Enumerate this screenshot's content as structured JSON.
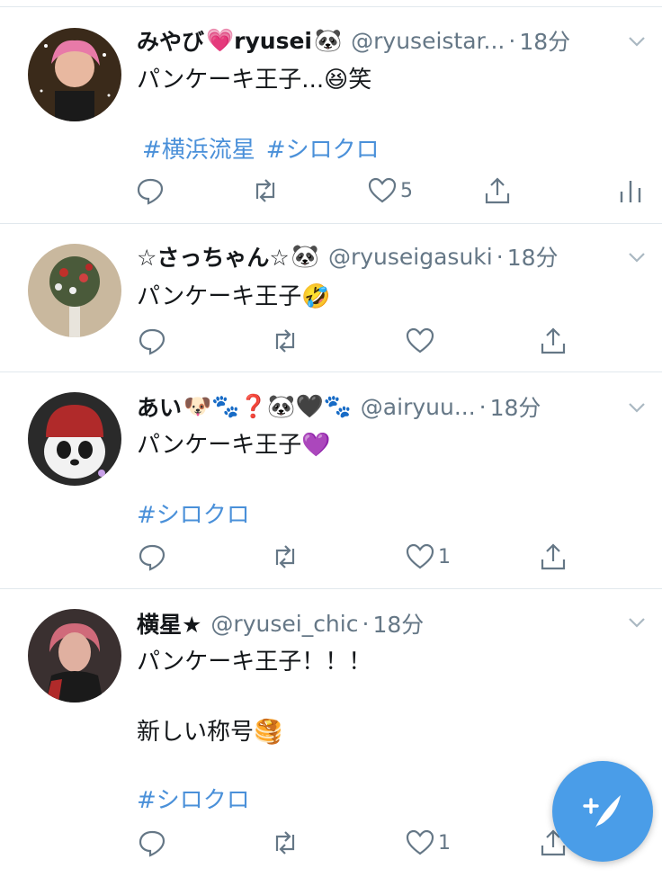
{
  "tweets": [
    {
      "name": "みやび",
      "name_emoji": "💗",
      "name2": "ryusei",
      "name_emoji2": "🐼",
      "handle": "@ryuseistar...",
      "time": "18分",
      "text": "パンケーキ王子...😆笑",
      "hashtags": [
        "#横浜流星",
        "#シロクロ"
      ],
      "likes": "5"
    },
    {
      "name": "☆さっちゃん☆",
      "name_emoji": "🐼",
      "handle": "@ryuseigasuki",
      "time": "18分",
      "text": "パンケーキ王子🤣"
    },
    {
      "name": "あい",
      "name_emoji": "🐶🐾❓🐼🖤🐾",
      "handle": "@airyuu...",
      "time": "18分",
      "text": "パンケーキ王子💜",
      "hashtags": [
        "#シロクロ"
      ],
      "likes": "1"
    },
    {
      "name": "横星★",
      "handle": "@ryusei_chic",
      "time": "18分",
      "text": "パンケーキ王子！！！",
      "text2": "新しい称号🥞",
      "hashtags": [
        "#シロクロ"
      ],
      "likes": "1"
    }
  ],
  "icons": {
    "reply": "reply-icon",
    "retweet": "retweet-icon",
    "like": "heart-icon",
    "share": "share-icon",
    "analytics": "analytics-icon",
    "compose": "compose-tweet-icon"
  },
  "colors": {
    "hashtag": "#4a90d9",
    "muted": "#657786",
    "fab": "#4a9de8"
  }
}
